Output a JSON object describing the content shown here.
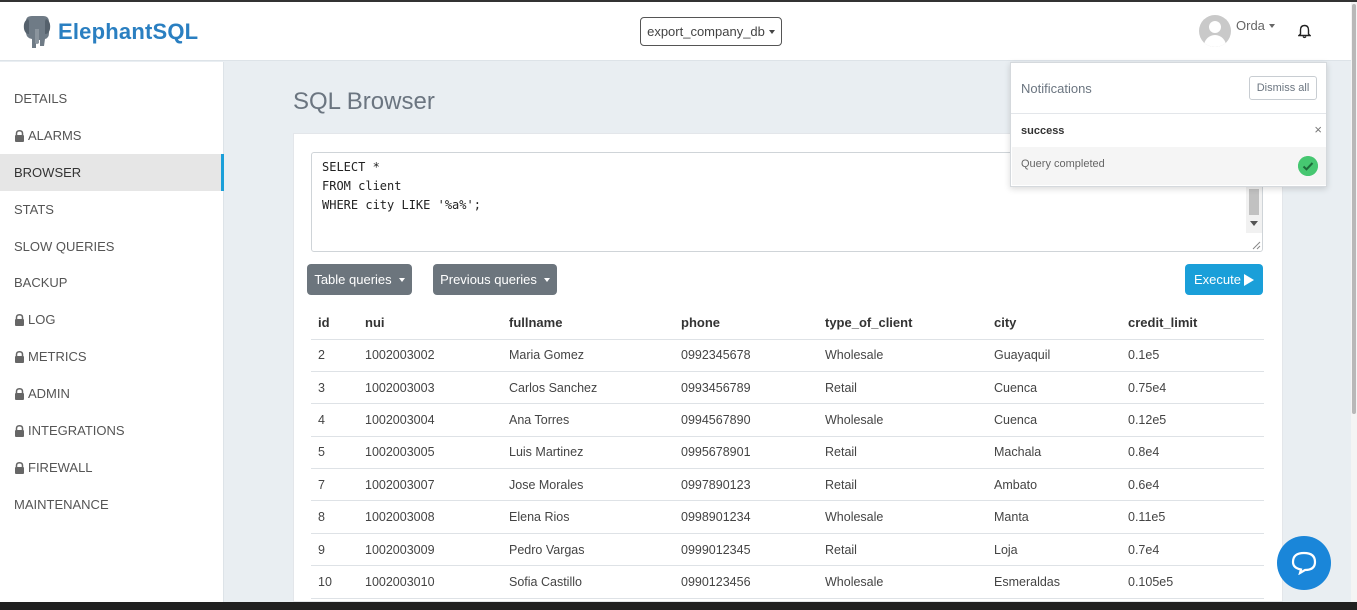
{
  "header": {
    "brand": "ElephantSQL",
    "database": "export_company_db",
    "user": "Orda"
  },
  "sidebar": {
    "items": [
      {
        "label": "DETAILS",
        "locked": false,
        "active": false
      },
      {
        "label": "ALARMS",
        "locked": true,
        "active": false
      },
      {
        "label": "BROWSER",
        "locked": false,
        "active": true
      },
      {
        "label": "STATS",
        "locked": false,
        "active": false
      },
      {
        "label": "SLOW QUERIES",
        "locked": false,
        "active": false
      },
      {
        "label": "BACKUP",
        "locked": false,
        "active": false
      },
      {
        "label": "LOG",
        "locked": true,
        "active": false
      },
      {
        "label": "METRICS",
        "locked": true,
        "active": false
      },
      {
        "label": "ADMIN",
        "locked": true,
        "active": false
      },
      {
        "label": "INTEGRATIONS",
        "locked": true,
        "active": false
      },
      {
        "label": "FIREWALL",
        "locked": true,
        "active": false
      },
      {
        "label": "MAINTENANCE",
        "locked": false,
        "active": false
      }
    ]
  },
  "main": {
    "title": "SQL Browser",
    "query_lines": [
      "SELECT *",
      "FROM client",
      "WHERE city LIKE '%a%';"
    ],
    "table_queries_label": "Table queries",
    "previous_queries_label": "Previous queries",
    "execute_label": "Execute"
  },
  "results": {
    "columns": [
      "id",
      "nui",
      "fullname",
      "phone",
      "type_of_client",
      "city",
      "credit_limit"
    ],
    "rows": [
      [
        "2",
        "1002003002",
        "Maria Gomez",
        "0992345678",
        "Wholesale",
        "Guayaquil",
        "0.1e5"
      ],
      [
        "3",
        "1002003003",
        "Carlos Sanchez",
        "0993456789",
        "Retail",
        "Cuenca",
        "0.75e4"
      ],
      [
        "4",
        "1002003004",
        "Ana Torres",
        "0994567890",
        "Wholesale",
        "Cuenca",
        "0.12e5"
      ],
      [
        "5",
        "1002003005",
        "Luis Martinez",
        "0995678901",
        "Retail",
        "Machala",
        "0.8e4"
      ],
      [
        "7",
        "1002003007",
        "Jose Morales",
        "0997890123",
        "Retail",
        "Ambato",
        "0.6e4"
      ],
      [
        "8",
        "1002003008",
        "Elena Rios",
        "0998901234",
        "Wholesale",
        "Manta",
        "0.11e5"
      ],
      [
        "9",
        "1002003009",
        "Pedro Vargas",
        "0999012345",
        "Retail",
        "Loja",
        "0.7e4"
      ],
      [
        "10",
        "1002003010",
        "Sofia Castillo",
        "0990123456",
        "Wholesale",
        "Esmeraldas",
        "0.105e5"
      ]
    ]
  },
  "notifications": {
    "title": "Notifications",
    "dismiss_label": "Dismiss all",
    "type": "success",
    "close_symbol": "×",
    "message": "Query completed"
  },
  "colors": {
    "brand": "#2a7fc1",
    "accent": "#1a9fd9",
    "success": "#46c771"
  }
}
